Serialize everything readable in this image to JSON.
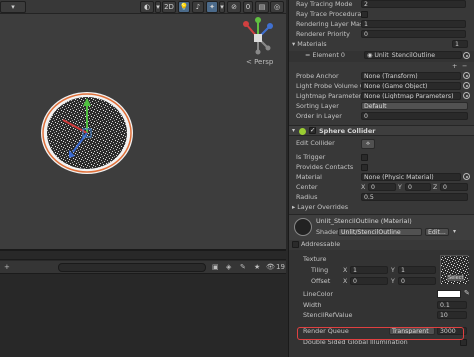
{
  "scene": {
    "toolbar": {
      "mode_2d": "2D",
      "persp_label": "< Persp"
    },
    "lower_count": "19"
  },
  "inspector": {
    "top_rows": [
      {
        "label": "Ray Tracing Mode",
        "value": "2"
      },
      {
        "label": "Ray Trace Procedural",
        "value": ""
      },
      {
        "label": "Rendering Layer Mask",
        "value": "1"
      },
      {
        "label": "Renderer Priority",
        "value": "0"
      }
    ],
    "materials": {
      "header": "Materials",
      "count": "1",
      "element_label": "Element 0",
      "element_value": "Unlit_StencilOutline"
    },
    "probe_rows": [
      {
        "label": "Probe Anchor",
        "value": "None (Transform)"
      },
      {
        "label": "Light Probe Volume Ov",
        "value": "None (Game Object)"
      },
      {
        "label": "Lightmap Parameters",
        "value": "None (Lightmap Parameters)"
      },
      {
        "label": "Sorting Layer",
        "value": "Default"
      },
      {
        "label": "Order in Layer",
        "value": "0"
      }
    ],
    "sphere_collider": {
      "title": "Sphere Collider",
      "edit_collider": "Edit Collider",
      "is_trigger": "Is Trigger",
      "provides_contacts": "Provides Contacts",
      "material_label": "Material",
      "material_value": "None (Physic Material)",
      "center_label": "Center",
      "center": {
        "x": "0",
        "y": "0",
        "z": "0"
      },
      "radius_label": "Radius",
      "radius_value": "0.5",
      "layer_overrides": "Layer Overrides"
    },
    "material": {
      "name": "Unlit_StencilOutline (Material)",
      "shader_label": "Shader",
      "shader_value": "Unlit/StencilOutline",
      "edit_button": "Edit...",
      "addressable": "Addressable",
      "texture_label": "Texture",
      "tiling_label": "Tiling",
      "tiling": {
        "x": "1",
        "y": "1"
      },
      "offset_label": "Offset",
      "offset": {
        "x": "0",
        "y": "0"
      },
      "select_button": "Select",
      "line_color_label": "LineColor",
      "width_label": "Width",
      "width_value": "0.1",
      "stencil_label": "StencilRefValue",
      "stencil_value": "10",
      "render_queue_label": "Render Queue",
      "render_queue_mode": "Transparent",
      "render_queue_value": "3000",
      "double_sided_label": "Double Sided Global Illumination"
    }
  },
  "colors": {
    "highlight": "#e04040",
    "sphere_rim": "#e0703a",
    "collider_icon": "#9acd32"
  }
}
